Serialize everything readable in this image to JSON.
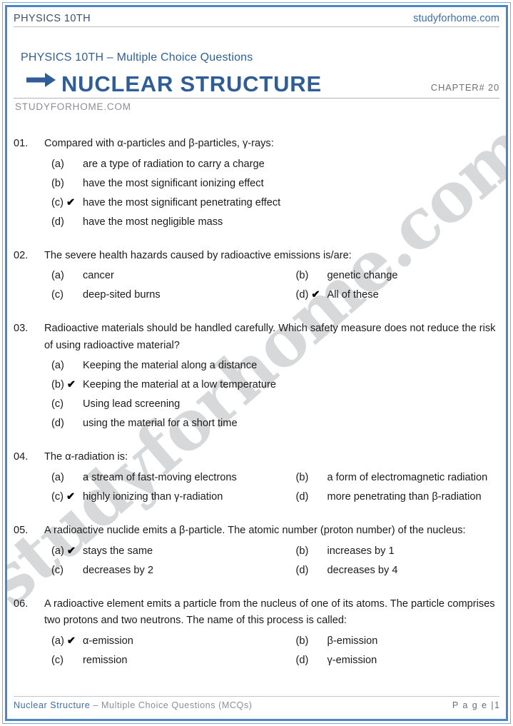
{
  "running_header": {
    "left": "PHYSICS 10TH",
    "right": "studyforhome.com"
  },
  "title_block": {
    "subject_line": "PHYSICS 10TH – Multiple Choice Questions",
    "arrow_icon": "arrow-right-icon",
    "title": "NUCLEAR STRUCTURE",
    "chapter": "CHAPTER# 20",
    "site_caption": "STUDYFORHOME.COM"
  },
  "watermark": "studyforhome.com",
  "colors": {
    "frame_blue": "#4a86c8",
    "frame_blue_light": "#7aa9dd",
    "title_blue": "#2f5d96",
    "link_blue": "#3f6ea8",
    "body_text": "#1b1b1b",
    "muted": "#8b8f94",
    "watermark": "#d6d8da"
  },
  "questions": [
    {
      "number": "01.",
      "text": "Compared with α-particles and β-particles, γ-rays:",
      "layout": "single",
      "options": [
        {
          "letter": "(a)",
          "correct": false,
          "text": "are a type of radiation to carry a charge"
        },
        {
          "letter": "(b)",
          "correct": false,
          "text": "have the most significant ionizing effect"
        },
        {
          "letter": "(c)",
          "correct": true,
          "text": "have the most significant penetrating effect"
        },
        {
          "letter": "(d)",
          "correct": false,
          "text": "have the most negligible mass"
        }
      ]
    },
    {
      "number": "02.",
      "text": "The severe health hazards caused by radioactive emissions is/are:",
      "layout": "double",
      "options": [
        {
          "letter": "(a)",
          "correct": false,
          "text": "cancer"
        },
        {
          "letter": "(b)",
          "correct": false,
          "text": "genetic change"
        },
        {
          "letter": "(c)",
          "correct": false,
          "text": "deep-sited burns"
        },
        {
          "letter": "(d)",
          "correct": true,
          "text": "All of these"
        }
      ]
    },
    {
      "number": "03.",
      "text": "Radioactive materials should be handled carefully. Which safety measure does not reduce the risk of using radioactive material?",
      "layout": "single",
      "options": [
        {
          "letter": "(a)",
          "correct": false,
          "text": "Keeping the material along a distance"
        },
        {
          "letter": "(b)",
          "correct": true,
          "text": "Keeping the material at a low temperature"
        },
        {
          "letter": "(c)",
          "correct": false,
          "text": "Using lead screening"
        },
        {
          "letter": "(d)",
          "correct": false,
          "text": "using the material for a short time"
        }
      ]
    },
    {
      "number": "04.",
      "text": "The α-radiation is:",
      "layout": "double",
      "options": [
        {
          "letter": "(a)",
          "correct": false,
          "text": "a stream of fast-moving electrons"
        },
        {
          "letter": "(b)",
          "correct": false,
          "text": "a form of electromagnetic radiation"
        },
        {
          "letter": "(c)",
          "correct": true,
          "text": "highly ionizing than γ-radiation"
        },
        {
          "letter": "(d)",
          "correct": false,
          "text": "more penetrating than β-radiation"
        }
      ]
    },
    {
      "number": "05.",
      "text": "A radioactive nuclide emits a β-particle. The atomic number (proton number) of the nucleus:",
      "layout": "double",
      "options": [
        {
          "letter": "(a)",
          "correct": true,
          "text": "stays the same"
        },
        {
          "letter": "(b)",
          "correct": false,
          "text": "increases by 1"
        },
        {
          "letter": "(c)",
          "correct": false,
          "text": "decreases by 2"
        },
        {
          "letter": "(d)",
          "correct": false,
          "text": "decreases by 4"
        }
      ]
    },
    {
      "number": "06.",
      "text": "A radioactive element emits a particle from the nucleus of one of its atoms. The particle comprises two protons and two neutrons. The name of this process is called:",
      "layout": "double",
      "options": [
        {
          "letter": "(a)",
          "correct": true,
          "text": "α-emission"
        },
        {
          "letter": "(b)",
          "correct": false,
          "text": "β-emission"
        },
        {
          "letter": "(c)",
          "correct": false,
          "text": "remission"
        },
        {
          "letter": "(d)",
          "correct": false,
          "text": "γ-emission"
        }
      ]
    }
  ],
  "tick_glyph": "✔",
  "footer": {
    "chapter_name": "Nuclear Structure",
    "rest": " – Multiple Choice Questions (MCQs)",
    "page_label": "P a g e  |",
    "page_number": "1"
  }
}
